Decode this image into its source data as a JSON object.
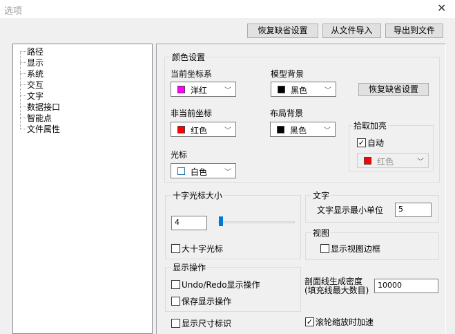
{
  "window": {
    "title": "选项"
  },
  "toolbar": {
    "restore_defaults": "恢复缺省设置",
    "import_file": "从文件导入",
    "export_file": "导出到文件"
  },
  "tree": [
    "路径",
    "显示",
    "系统",
    "交互",
    "文字",
    "数据接口",
    "智能点",
    "文件属性"
  ],
  "color_settings": {
    "label": "颜色设置",
    "current_cs": {
      "label": "当前坐标系",
      "value": "洋红",
      "color": "#ff00ff"
    },
    "model_bg": {
      "label": "模型背景",
      "value": "黑色",
      "color": "#000000"
    },
    "restore": "恢复缺省设置",
    "non_current_cs": {
      "label": "非当前坐标",
      "value": "红色",
      "color": "#ff0000"
    },
    "layout_bg": {
      "label": "布局背景",
      "value": "黑色",
      "color": "#000000"
    },
    "cursor": {
      "label": "光标",
      "value": "白色",
      "color": "#ffffff"
    },
    "pick_highlight": {
      "label": "拾取加亮",
      "auto_label": "自动",
      "auto": true,
      "value": "红色",
      "color": "#ff0000"
    }
  },
  "crosshair": {
    "label": "十字光标大小",
    "value": "4",
    "slider_percent": 4,
    "big_label": "大十字光标",
    "big": false
  },
  "text": {
    "label": "文字",
    "min_unit_label": "文字显示最小单位",
    "min_unit": "5"
  },
  "view": {
    "label": "视图",
    "border_label": "显示视图边框",
    "border": false
  },
  "display_ops": {
    "label": "显示操作",
    "undo_label": "Undo/Redo显示操作",
    "undo": false,
    "save_label": "保存显示操作",
    "save": false
  },
  "hatch": {
    "label1": "剖面线生成密度",
    "label2": "(填充线最大数目)",
    "value": "10000"
  },
  "dim_marks": {
    "label": "显示尺寸标识",
    "checked": false
  },
  "wheel_accel": {
    "label": "滚轮缩放时加速",
    "checked": true
  }
}
